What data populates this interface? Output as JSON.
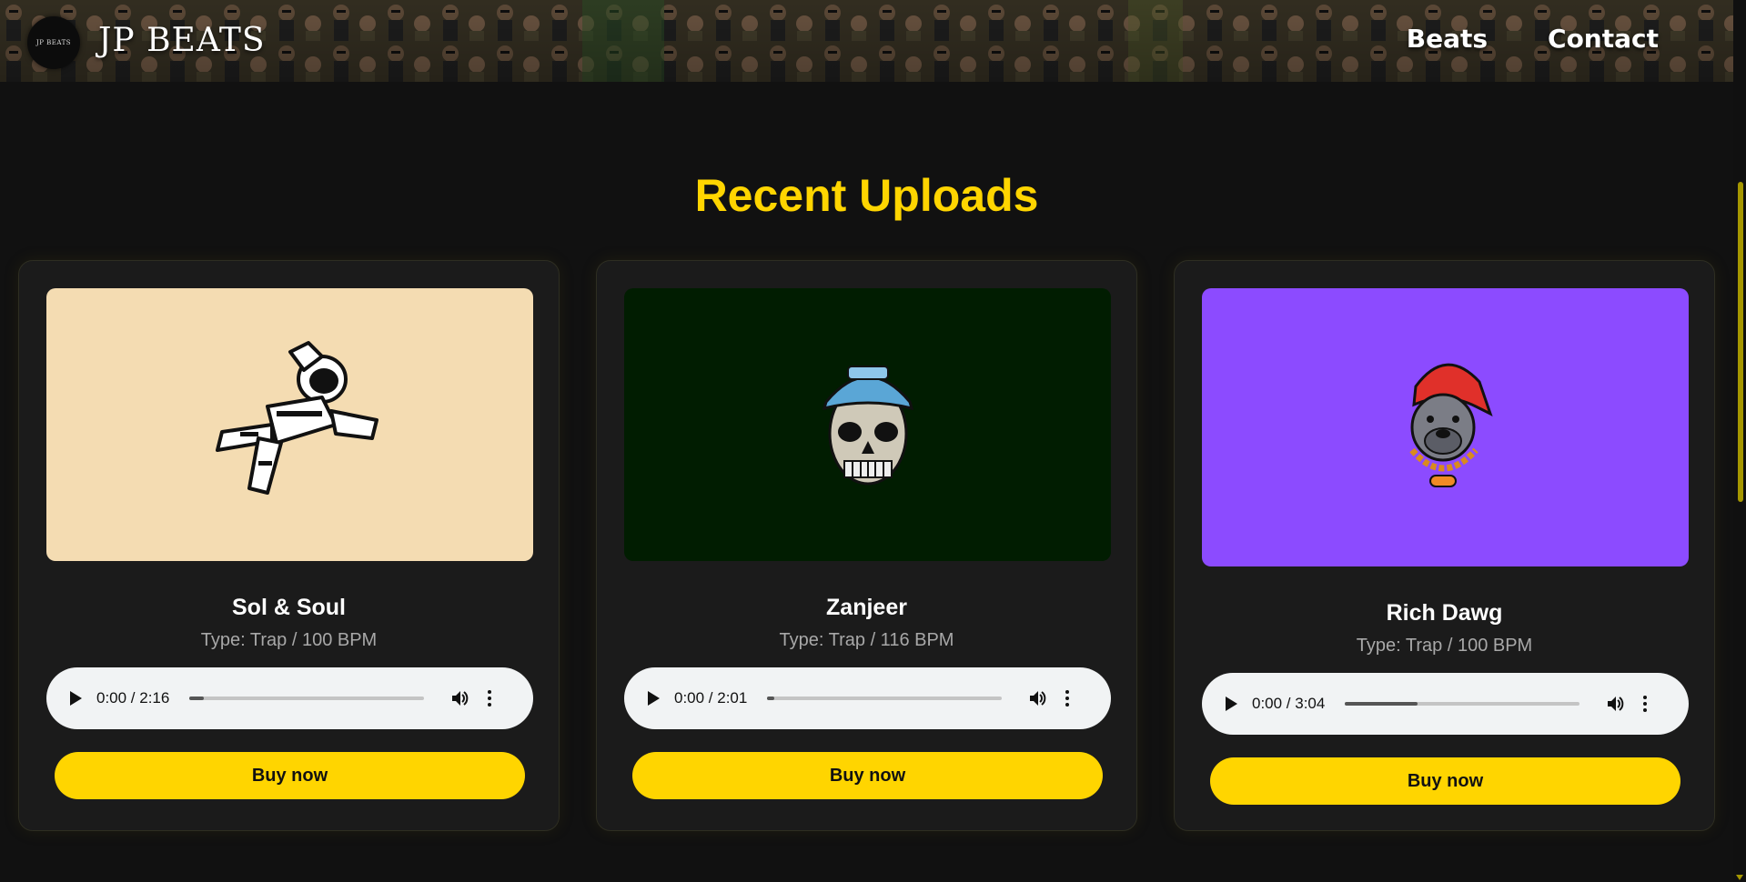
{
  "header": {
    "logo_text": "JP BEATS",
    "brand": "JP BEATS",
    "nav": [
      {
        "label": "Beats"
      },
      {
        "label": "Contact"
      }
    ]
  },
  "main": {
    "section_title": "Recent Uploads",
    "beats": [
      {
        "title": "Sol & Soul",
        "type": "Type: Trap / 100 BPM",
        "time": "0:00 / 2:16",
        "progress": 0.06,
        "buy_label": "Buy now",
        "cover_color": "#f4dcb2",
        "art": "astronaut-illustration"
      },
      {
        "title": "Zanjeer",
        "type": "Type: Trap / 116 BPM",
        "time": "0:00 / 2:01",
        "progress": 0.03,
        "buy_label": "Buy now",
        "cover_color": "#011d01",
        "art": "skull-with-cap-illustration"
      },
      {
        "title": "Rich Dawg",
        "type": "Type: Trap / 100 BPM",
        "time": "0:00 / 3:04",
        "progress": 0.31,
        "buy_label": "Buy now",
        "cover_color": "#8c4bff",
        "art": "bulldog-with-cap-and-chain-illustration"
      }
    ]
  },
  "colors": {
    "accent": "#ffd500",
    "background": "#111111",
    "card": "#1b1b1b"
  }
}
